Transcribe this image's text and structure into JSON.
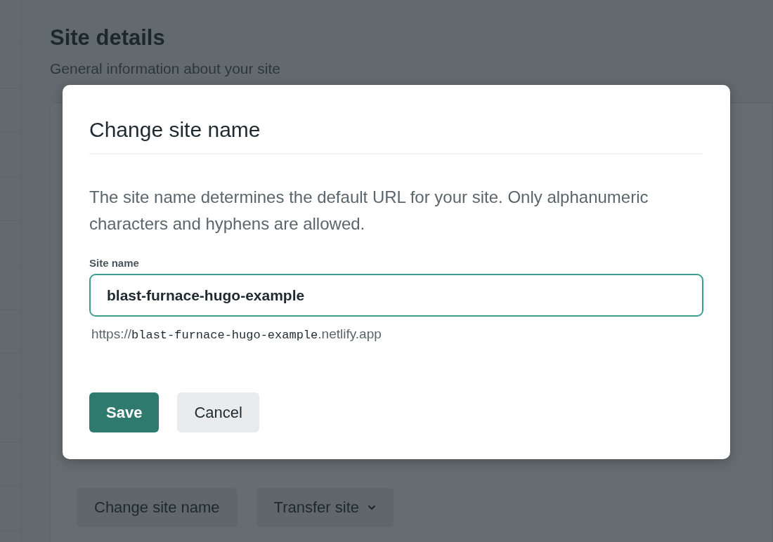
{
  "page": {
    "title": "Site details",
    "subtitle": "General information about your site",
    "actions": [
      {
        "label": "Change site name",
        "kind": "plain"
      },
      {
        "label": "Transfer site",
        "kind": "dropdown"
      }
    ]
  },
  "dialog": {
    "title": "Change site name",
    "description": "The site name determines the default URL for your site. Only alphanumeric characters and hyphens are allowed.",
    "field": {
      "label": "Site name",
      "value": "blast-furnace-hugo-example",
      "focused": true
    },
    "url_preview": {
      "prefix": "https://",
      "site": "blast-furnace-hugo-example",
      "suffix": ".netlify.app"
    },
    "buttons": [
      {
        "label": "Save",
        "kind": "primary"
      },
      {
        "label": "Cancel",
        "kind": "secondary"
      }
    ]
  }
}
